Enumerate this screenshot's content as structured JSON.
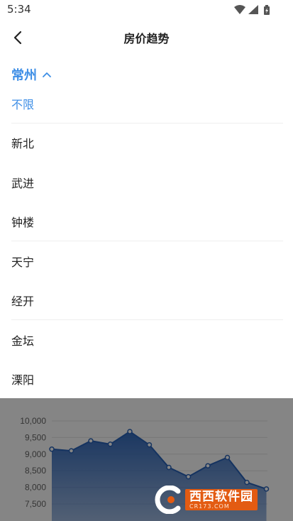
{
  "status_bar": {
    "time": "5:34"
  },
  "nav": {
    "title": "房价趋势"
  },
  "city_selector": {
    "city": "常州",
    "expanded": true
  },
  "districts": [
    {
      "label": "不限",
      "selected": true
    },
    {
      "label": "新北",
      "selected": false
    },
    {
      "label": "武进",
      "selected": false
    },
    {
      "label": "钟楼",
      "selected": false
    },
    {
      "label": "天宁",
      "selected": false
    },
    {
      "label": "经开",
      "selected": false
    },
    {
      "label": "金坛",
      "selected": false
    },
    {
      "label": "溧阳",
      "selected": false
    }
  ],
  "chart_data": {
    "type": "area",
    "title": "",
    "xlabel": "",
    "ylabel": "",
    "y_ticks": [
      "10,000",
      "9,500",
      "9,000",
      "8,500",
      "8,000",
      "7,500"
    ],
    "ylim": [
      7500,
      10000
    ],
    "grid": true,
    "series": [
      {
        "values": [
          9150,
          9100,
          9400,
          9300,
          9680,
          9280,
          8600,
          8320,
          8650,
          8900,
          8150,
          7950
        ]
      }
    ]
  },
  "watermark": {
    "brand": "西西软件园",
    "url": "CR173.COM"
  },
  "colors": {
    "accent": "#3d8ee6",
    "line": "#2a63b8",
    "watermark": "#e35b12"
  }
}
